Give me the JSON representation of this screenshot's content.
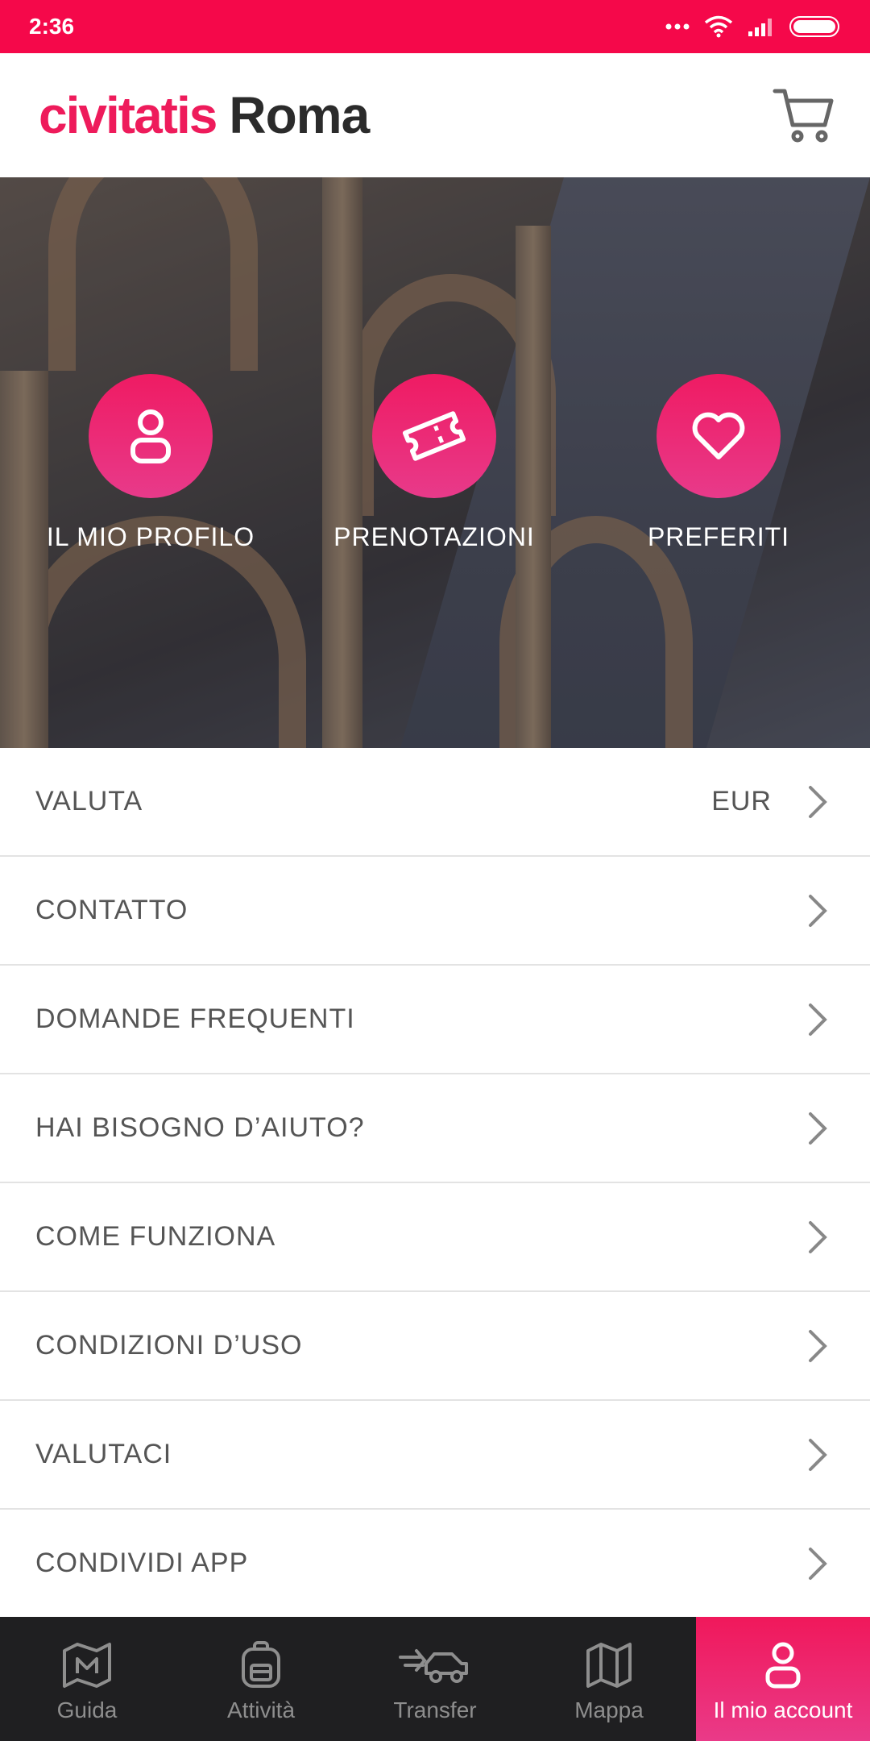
{
  "status_bar": {
    "time": "2:36"
  },
  "header": {
    "brand": "civitatis",
    "city": "Roma"
  },
  "quick_actions": [
    {
      "label": "IL MIO PROFILO",
      "icon": "user-icon"
    },
    {
      "label": "PRENOTAZIONI",
      "icon": "ticket-icon"
    },
    {
      "label": "PREFERITI",
      "icon": "heart-icon"
    }
  ],
  "menu": [
    {
      "label": "VALUTA",
      "value": "EUR"
    },
    {
      "label": "CONTATTO"
    },
    {
      "label": "DOMANDE FREQUENTI"
    },
    {
      "label": "HAI BISOGNO D’AIUTO?"
    },
    {
      "label": "COME FUNZIONA"
    },
    {
      "label": "CONDIZIONI D’USO"
    },
    {
      "label": "VALUTACI"
    },
    {
      "label": "CONDIVIDI APP"
    }
  ],
  "bottom_nav": [
    {
      "label": "Guida",
      "icon": "map-guide-icon"
    },
    {
      "label": "Attività",
      "icon": "backpack-icon"
    },
    {
      "label": "Transfer",
      "icon": "transfer-car-icon"
    },
    {
      "label": "Mappa",
      "icon": "map-icon"
    },
    {
      "label": "Il mio account",
      "icon": "user-icon",
      "active": true
    }
  ],
  "colors": {
    "accent": "#ee1b5b",
    "nav_bg": "#1f1f21",
    "text": "#555555"
  }
}
